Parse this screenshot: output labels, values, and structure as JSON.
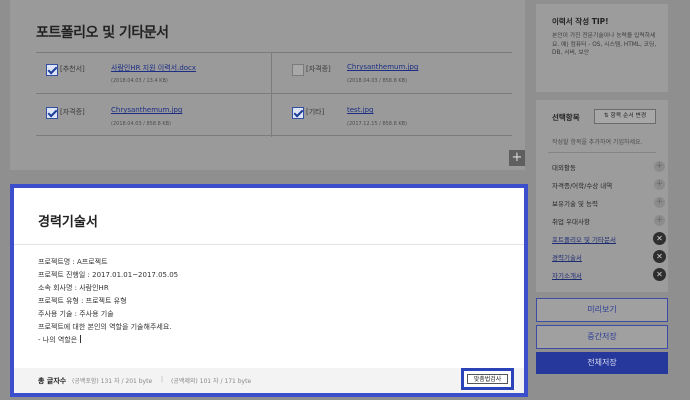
{
  "portfolio": {
    "title": "포트폴리오 및 기타문서",
    "items": [
      {
        "tag": "[추천서]",
        "file": "사람인HR 지원 이력서.docx",
        "meta": "(2018.04.03 / 13.4 KB)",
        "checked": true
      },
      {
        "tag": "[자격증]",
        "file": "Chrysanthemum.jpg",
        "meta": "(2018.04.03 / 858.8 KB)",
        "checked": false
      },
      {
        "tag": "[자격증]",
        "file": "Chrysanthemum.jpg",
        "meta": "(2018.04.03 / 858.8 KB)",
        "checked": true
      },
      {
        "tag": "[기타]",
        "file": "test.jpg",
        "meta": "(2017.12.15 / 858.8 KB)",
        "checked": true
      }
    ],
    "add_label": "+"
  },
  "career": {
    "title": "경력기술서",
    "lines": [
      "프로젝트명 : A프로젝트",
      "프로젝트 진행일 : 2017.01.01~2017.05.05",
      "소속 회사명 : 사람인HR",
      "프로젝트 유형 : 프로젝트 유형",
      "주사용 기술 : 주사용 기술",
      "프로젝트에 대한 본인의 역할을 기술해주세요.",
      "- 나의 역할은 "
    ],
    "count_label": "총 글자수",
    "count_incl": "(공백포함) 131 자 / 201 byte",
    "count_sep": "|",
    "count_excl": "(공백제외) 101 자 / 171 byte",
    "spell_check_label": "맞춤법검사"
  },
  "tips": {
    "title": "이력서 작성 TIP!",
    "body": "본인이 가진 전문기술이나 능력을 입력하세요. 예) 컴퓨터 - OS, 시스템, HTML, 코딩, DB, 서버, 보안"
  },
  "selection": {
    "title": "선택항목",
    "order_button": "⇅ 항목 순서 변경",
    "hint": "작성할 항목을 추가하여 기입하세요.",
    "plus_symbol": "+",
    "remove_symbol": "✕",
    "items": [
      {
        "label": "대외활동",
        "state": "add"
      },
      {
        "label": "자격증/어학/수상 내역",
        "state": "add"
      },
      {
        "label": "보유기술 및 능력",
        "state": "add"
      },
      {
        "label": "취업 우대사항",
        "state": "add"
      },
      {
        "label": "포트폴리오 및 기타문서",
        "state": "added"
      },
      {
        "label": "경력기술서",
        "state": "added"
      },
      {
        "label": "자기소개서",
        "state": "added"
      }
    ]
  },
  "actions": {
    "preview": "미리보기",
    "temp_save": "중간저장",
    "save": "전체저장"
  }
}
